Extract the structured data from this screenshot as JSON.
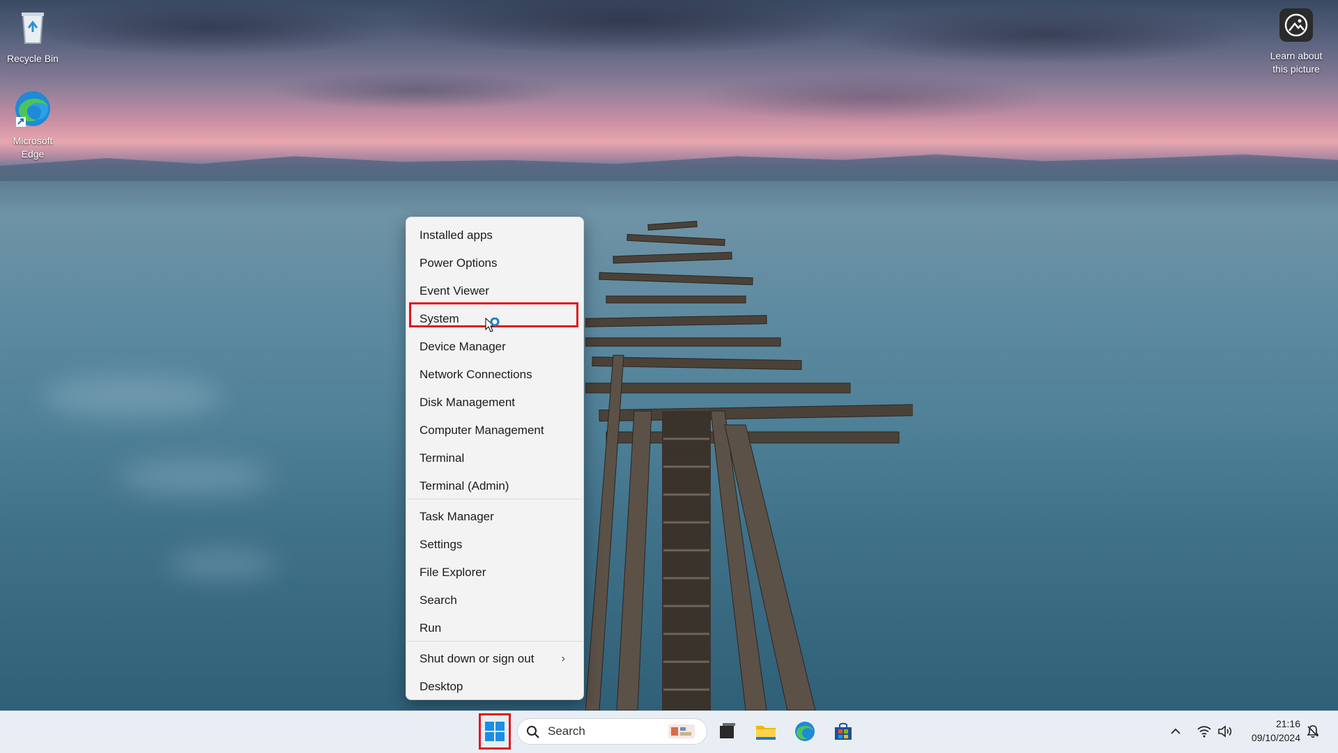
{
  "desktop": {
    "icons": [
      {
        "label": "Recycle Bin",
        "icon": "recycle-bin-icon"
      },
      {
        "label_line1": "Microsoft",
        "label_line2": "Edge",
        "icon": "edge-icon"
      },
      {
        "label_line1": "Learn about",
        "label_line2": "this picture",
        "icon": "learn-picture-icon"
      }
    ]
  },
  "context_menu": {
    "group1": [
      "Installed apps",
      "Power Options",
      "Event Viewer",
      "System",
      "Device Manager",
      "Network Connections",
      "Disk Management",
      "Computer Management",
      "Terminal",
      "Terminal (Admin)"
    ],
    "group2": [
      "Task Manager",
      "Settings",
      "File Explorer",
      "Search",
      "Run"
    ],
    "group3": [
      "Shut down or sign out",
      "Desktop"
    ],
    "highlighted_item": "System"
  },
  "taskbar": {
    "search_placeholder": "Search",
    "pinned": [
      "start-icon",
      "task-view-icon",
      "file-explorer-icon",
      "edge-icon",
      "store-icon"
    ],
    "tray": {
      "time": "21:16",
      "date": "09/10/2024"
    }
  },
  "colors": {
    "highlight_border": "#e0141e",
    "menu_bg": "#f3f3f3",
    "taskbar_bg": "#e9eef4"
  }
}
